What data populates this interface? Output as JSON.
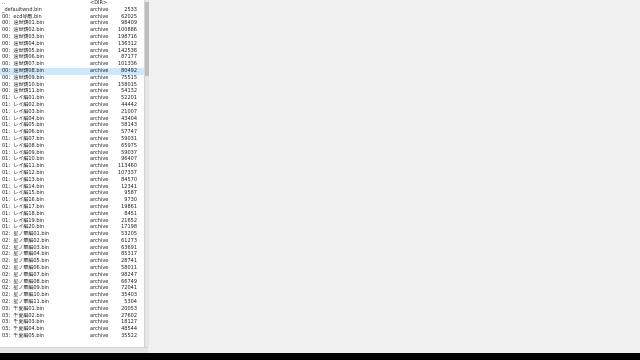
{
  "header": {
    "name": "..",
    "type": "<DIR>",
    "size": ""
  },
  "files": [
    {
      "name": "_defaultwnd.bin",
      "type": "archive",
      "size": "2533"
    },
    {
      "name": "00：ecd琴敵.bin",
      "type": "archive",
      "size": "62025"
    },
    {
      "name": "00：遠世鋳01.bin",
      "type": "archive",
      "size": "98409"
    },
    {
      "name": "00：遠世鋳02.bin",
      "type": "archive",
      "size": "100886"
    },
    {
      "name": "00：遠世鋳03.bin",
      "type": "archive",
      "size": "198716"
    },
    {
      "name": "00：遠世鋳04.bin",
      "type": "archive",
      "size": "136312"
    },
    {
      "name": "00：遠世鋳05.bin",
      "type": "archive",
      "size": "142538"
    },
    {
      "name": "00：遠世鋳06.bin",
      "type": "archive",
      "size": "87177"
    },
    {
      "name": "00：遠世鋳07.bin",
      "type": "archive",
      "size": "101336"
    },
    {
      "name": "00：遠世鋳08.bin",
      "type": "archive",
      "size": "80492",
      "selected": true
    },
    {
      "name": "00：遠世鋳09.bin",
      "type": "archive",
      "size": "75515"
    },
    {
      "name": "00：遠世鋳10.bin",
      "type": "archive",
      "size": "158015"
    },
    {
      "name": "00：遠世鋳11.bin",
      "type": "archive",
      "size": "54132"
    },
    {
      "name": "01：レイ編01.bin",
      "type": "archive",
      "size": "52201"
    },
    {
      "name": "01：レイ編02.bin",
      "type": "archive",
      "size": "44442"
    },
    {
      "name": "01：レイ編03.bin",
      "type": "archive",
      "size": "21007"
    },
    {
      "name": "01：レイ編04.bin",
      "type": "archive",
      "size": "43404"
    },
    {
      "name": "01：レイ編05.bin",
      "type": "archive",
      "size": "58143"
    },
    {
      "name": "01：レイ編06.bin",
      "type": "archive",
      "size": "57747"
    },
    {
      "name": "01：レイ編07.bin",
      "type": "archive",
      "size": "59031"
    },
    {
      "name": "01：レイ編08.bin",
      "type": "archive",
      "size": "65975"
    },
    {
      "name": "01：レイ編09.bin",
      "type": "archive",
      "size": "59037"
    },
    {
      "name": "01：レイ編10.bin",
      "type": "archive",
      "size": "96407"
    },
    {
      "name": "01：レイ編11.bin",
      "type": "archive",
      "size": "113460"
    },
    {
      "name": "01：レイ編12.bin",
      "type": "archive",
      "size": "107337"
    },
    {
      "name": "01：レイ編13.bin",
      "type": "archive",
      "size": "84570"
    },
    {
      "name": "01：レイ編14.bin",
      "type": "archive",
      "size": "12341"
    },
    {
      "name": "01：レイ編15.bin",
      "type": "archive",
      "size": "9587"
    },
    {
      "name": "01：レイ編16.bin",
      "type": "archive",
      "size": "9730"
    },
    {
      "name": "01：レイ編17.bin",
      "type": "archive",
      "size": "19861"
    },
    {
      "name": "01：レイ編18.bin",
      "type": "archive",
      "size": "8451"
    },
    {
      "name": "01：レイ編19.bin",
      "type": "archive",
      "size": "21652"
    },
    {
      "name": "01：レイ編20.bin",
      "type": "archive",
      "size": "17198"
    },
    {
      "name": "02：星ノ華編01.bin",
      "type": "archive",
      "size": "53205"
    },
    {
      "name": "02：星ノ華編02.bin",
      "type": "archive",
      "size": "61273"
    },
    {
      "name": "02：星ノ華編03.bin",
      "type": "archive",
      "size": "63691"
    },
    {
      "name": "02：星ノ華編04.bin",
      "type": "archive",
      "size": "85317"
    },
    {
      "name": "02：星ノ華編05.bin",
      "type": "archive",
      "size": "28741"
    },
    {
      "name": "02：星ノ華編06.bin",
      "type": "archive",
      "size": "58011"
    },
    {
      "name": "02：星ノ華編07.bin",
      "type": "archive",
      "size": "98247"
    },
    {
      "name": "02：星ノ華編08.bin",
      "type": "archive",
      "size": "66749"
    },
    {
      "name": "02：星ノ華編09.bin",
      "type": "archive",
      "size": "72041"
    },
    {
      "name": "02：星ノ華編10.bin",
      "type": "archive",
      "size": "35403"
    },
    {
      "name": "02：星ノ華編11.bin",
      "type": "archive",
      "size": "5304"
    },
    {
      "name": "03：千夏編01.bin",
      "type": "archive",
      "size": "20053"
    },
    {
      "name": "03：千夏編02.bin",
      "type": "archive",
      "size": "27602"
    },
    {
      "name": "03：千夏編03.bin",
      "type": "archive",
      "size": "18127"
    },
    {
      "name": "03：千夏編04.bin",
      "type": "archive",
      "size": "48544"
    },
    {
      "name": "03：千夏編05.bin",
      "type": "archive",
      "size": "35522"
    }
  ]
}
